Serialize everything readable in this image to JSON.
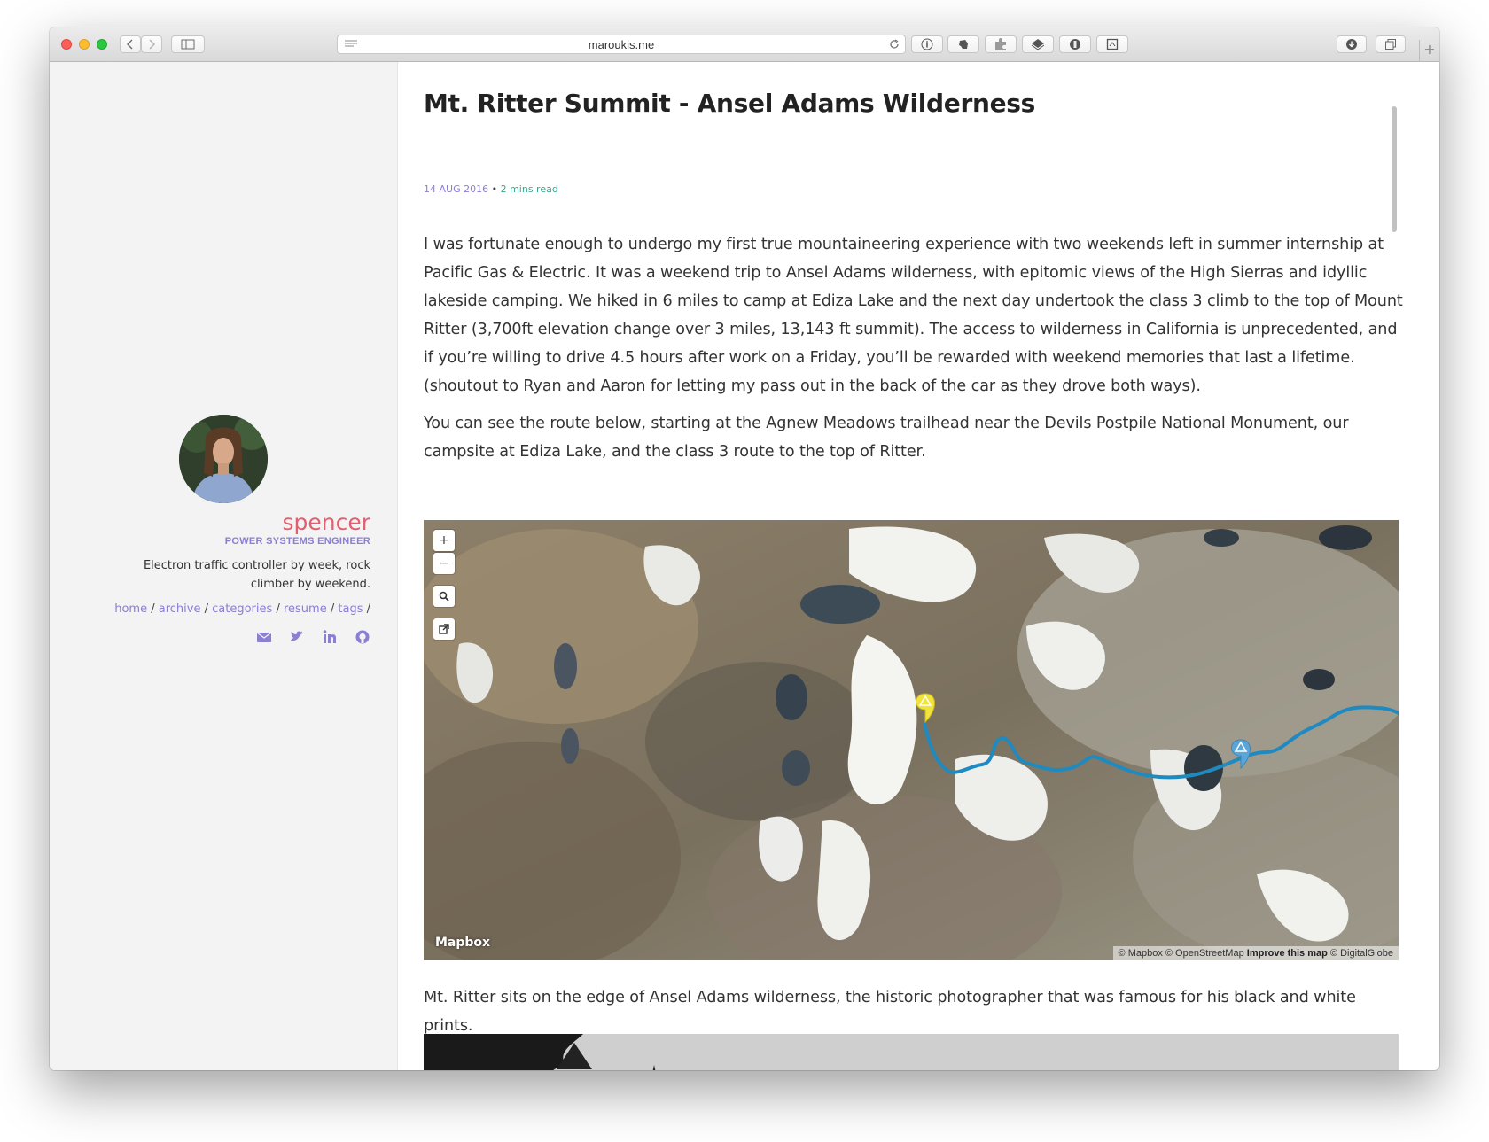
{
  "browser": {
    "url": "maroukis.me"
  },
  "sidebar": {
    "name": "spencer",
    "role": "POWER SYSTEMS ENGINEER",
    "bio": "Electron traffic controller by week, rock climber by weekend.",
    "nav": [
      "home",
      "archive",
      "categories",
      "resume",
      "tags"
    ],
    "nav_separator": "/",
    "socials": [
      "envelope-icon",
      "twitter-icon",
      "linkedin-icon",
      "github-icon"
    ],
    "accent_color": "#8a7fd1",
    "name_color": "#e06070"
  },
  "post": {
    "title": "Mt. Ritter Summit - Ansel Adams Wilderness",
    "date": "14 AUG 2016",
    "meta_separator": "•",
    "read_time": "2 mins read",
    "paragraphs": [
      "I was fortunate enough to undergo my first true mountaineering experience with two weekends left in summer internship at Pacific Gas & Electric. It was a weekend trip to Ansel Adams wilderness, with epitomic views of the High Sierras and idyllic lakeside camping. We hiked in 6 miles to camp at Ediza Lake and the next day undertook the class 3 climb to the top of Mount Ritter (3,700ft elevation change over 3 miles, 13,143 ft summit). The access to wilderness in California is unprecedented, and if you’re willing to drive 4.5 hours after work on a Friday, you’ll be rewarded with weekend memories that last a lifetime. (shoutout to Ryan and Aaron for letting my pass out in the back of the car as they drove both ways).",
      "You can see the route below, starting at the Agnew Meadows trailhead near the Devils Postpile National Monument, our campsite at Ediza Lake, and the class 3 route to the top of Ritter.",
      "Mt. Ritter sits on the edge of Ansel Adams wilderness, the historic photographer that was famous for his black and white prints."
    ]
  },
  "map": {
    "zoom_in": "+",
    "zoom_out": "−",
    "logo": "Mapbox",
    "attribution_1": "© Mapbox © OpenStreetMap",
    "attribution_improve": "Improve this map",
    "attribution_2": "© DigitalGlobe",
    "route_color": "#1f8ac0",
    "marker_summit_color": "#f2e33c",
    "marker_camp_color": "#5aa6d8"
  }
}
